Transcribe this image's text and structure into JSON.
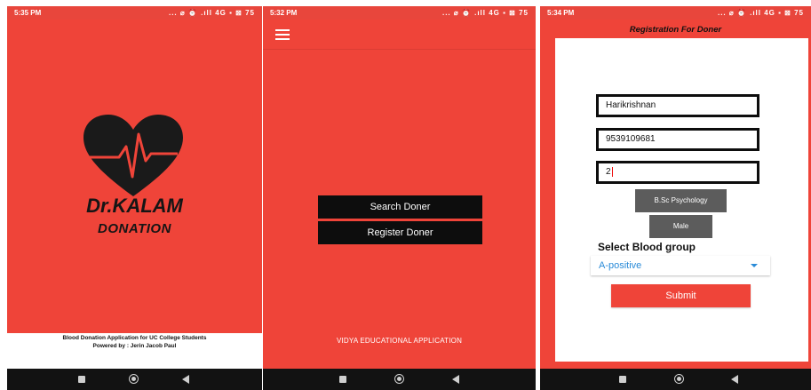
{
  "screen1": {
    "status": {
      "time": "5:35 PM",
      "icons": "... ⌀ ⏰ .ıll 4G ▪ ⊠ 75"
    },
    "brand_line1": "Dr.KALAM",
    "brand_line2": "DONATION",
    "footer_line1": "Blood Donation Application for UC College Students",
    "footer_line2": "Powered by : Jerin Jacob Paul",
    "colors": {
      "primary": "#ef4439",
      "heart": "#1a1a1a"
    }
  },
  "screen2": {
    "status": {
      "time": "5:32 PM",
      "icons": "... ⌀ ⏰ .ıll 4G ▪ ⊠ 75"
    },
    "buttons": {
      "search": "Search Doner",
      "register": "Register Doner"
    },
    "footer": "VIDYA EDUCATIONAL APPLICATION"
  },
  "screen3": {
    "status": {
      "time": "5:34 PM",
      "icons": "... ⌀ ⏰ .ıll 4G ▪ ⊠ 75"
    },
    "title": "Registration For Doner",
    "fields": {
      "name": "Harikrishnan",
      "phone": "9539109681",
      "third": "2"
    },
    "course_button": "B.Sc Psychology",
    "gender_button": "Male",
    "blood_group_label": "Select Blood group",
    "blood_group_value": "A-positive",
    "submit": "Submit"
  },
  "icons": [
    "heart-pulse-icon",
    "menu-icon",
    "dropdown-caret-icon",
    "nav-recents-icon",
    "nav-home-icon",
    "nav-back-icon"
  ]
}
